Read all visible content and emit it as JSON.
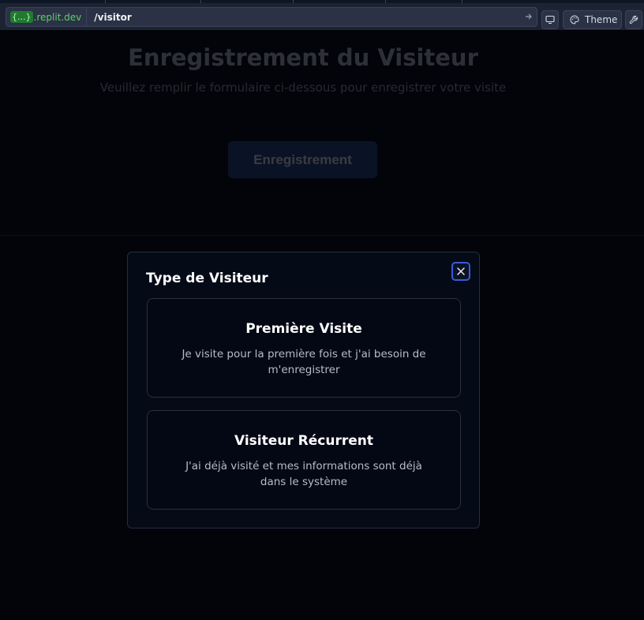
{
  "browser": {
    "domain_braces": "{...}",
    "domain": ".replit.dev",
    "path": "/visitor",
    "go_icon": "arrow-right-icon",
    "devtools_icon": "monitor-icon",
    "theme_icon": "palette-icon",
    "theme_label": "Theme",
    "tools_icon": "wrench-icon"
  },
  "page": {
    "title": "Enregistrement du Visiteur",
    "subtitle": "Veuillez remplir le formulaire ci-dessous pour enregistrer votre visite",
    "button_label": "Enregistrement"
  },
  "modal": {
    "title": "Type de Visiteur",
    "close_icon": "close-icon",
    "options": [
      {
        "title": "Première Visite",
        "description": "Je visite pour la première fois et j'ai besoin de m'enregistrer"
      },
      {
        "title": "Visiteur Récurrent",
        "description": "J'ai déjà visité et mes informations sont déjà dans le système"
      }
    ]
  },
  "colors": {
    "background": "#020409",
    "modal_background": "#050a17",
    "accent": "#3b5bd6",
    "domain_green": "#5bd16a"
  }
}
